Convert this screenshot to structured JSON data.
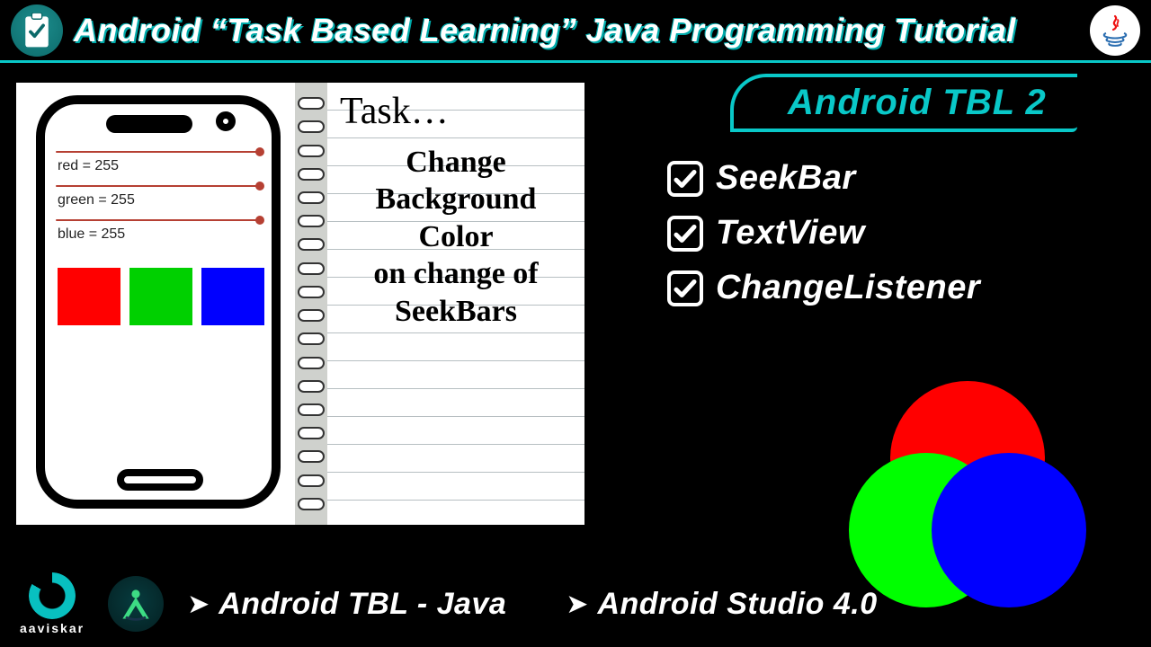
{
  "header": {
    "title": "Android “Task Based Learning” Java Programming Tutorial"
  },
  "phone": {
    "labels": {
      "red": "red = 255",
      "green": "green = 255",
      "blue": "blue = 255"
    }
  },
  "notebook": {
    "head": "Task…",
    "body_lines": [
      "Change",
      "Background",
      "Color",
      "on change of",
      "SeekBars"
    ]
  },
  "right": {
    "pill": "Android TBL 2",
    "checks": [
      "SeekBar",
      "TextView",
      "ChangeListener"
    ]
  },
  "footer": {
    "brand": "aaviskar",
    "chip1": "Android TBL - Java",
    "chip2": "Android Studio 4.0"
  }
}
